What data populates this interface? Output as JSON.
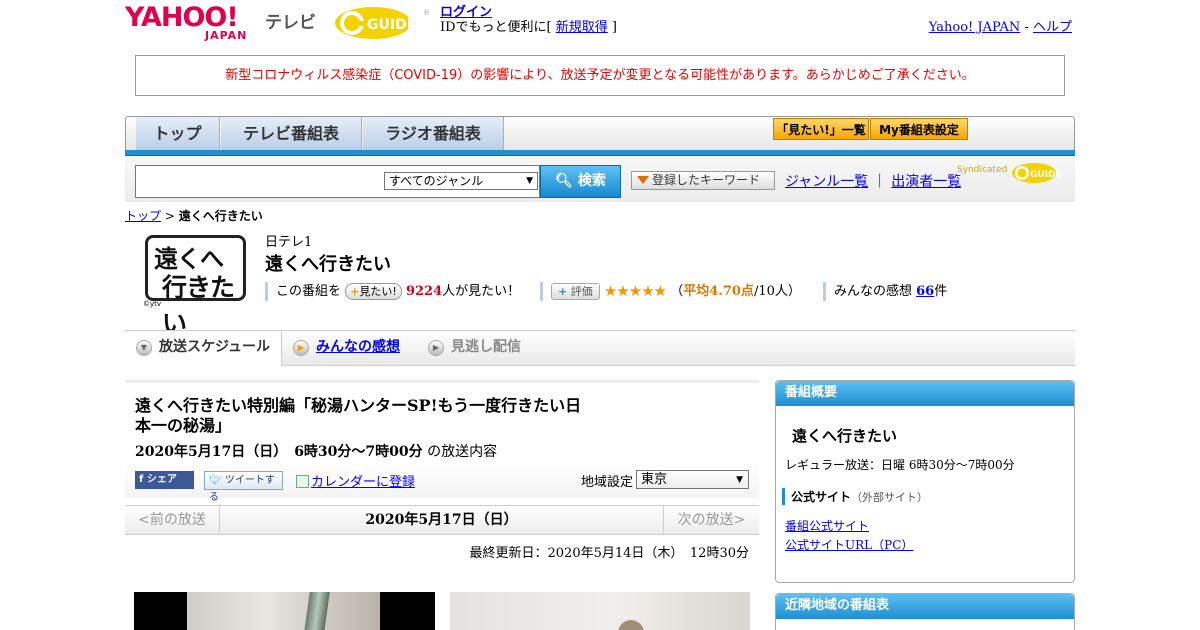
{
  "header": {
    "logo_yahoo": "YAHOO!",
    "logo_japan": "JAPAN",
    "logo_tv": "テレビ",
    "gguide": "G-GUIDE",
    "login": "ログイン",
    "login_sub_pre": "IDでもっと便利に[ ",
    "signup": "新規取得",
    "login_sub_post": " ]",
    "yahoo_japan": "Yahoo! JAPAN",
    "sep": " - ",
    "help": "ヘルプ"
  },
  "notice": "新型コロナウィルス感染症（COVID-19）の影響により、放送予定が変更となる可能性があります。あらかじめご了承ください。",
  "nav": {
    "tabs": [
      "トップ",
      "テレビ番組表",
      "ラジオ番組表"
    ],
    "want_list": "「見たい!」一覧",
    "my_guide": "My番組表設定"
  },
  "search": {
    "genre": "すべてのジャンル",
    "button": "検索",
    "keyword": "登録したキーワード",
    "genre_list": "ジャンル一覧",
    "divider": "｜",
    "cast_list": "出演者一覧",
    "syndicated": "Syndicated"
  },
  "breadcrumb": {
    "top": "トップ",
    "sep": " > ",
    "current": "遠くへ行きたい"
  },
  "program": {
    "logo_line1": "遠くへ",
    "logo_line2": "行きたい",
    "copyright": "©ytv",
    "station": "日テレ1",
    "title": "遠くへ行きたい",
    "want_pre": "この番組を",
    "want_btn": "見たい!",
    "want_count": "9224",
    "want_post": "人が見たい！",
    "eval_btn": "評価",
    "stars": "★★★★★",
    "avg_pre": "（",
    "avg": "平均4.70点",
    "avg_post": "/10人）",
    "impressions_pre": "みんなの感想 ",
    "impressions_count": "66",
    "impressions_post": "件"
  },
  "ptabs": {
    "schedule": "放送スケジュール",
    "impressions": "みんなの感想",
    "vod": "見逃し配信"
  },
  "episode": {
    "title": "遠くへ行きたい特別編「秘湯ハンターSP!もう一度行きたい日本一の秘湯」",
    "date": "2020年5月17日（日）　6時30分～7時00分",
    "date_suffix": "の放送内容",
    "share": "シェア",
    "tweet": "ツイートする",
    "calendar": "カレンダーに登録",
    "region_label": "地域設定",
    "region": "東京"
  },
  "daynav": {
    "prev": "<前の放送",
    "current": "2020年5月17日（日）",
    "next": "次の放送>"
  },
  "updated": "最終更新日：2020年5月14日（木）　12時30分",
  "sidebar": {
    "overview_head": "番組概要",
    "name": "遠くへ行きたい",
    "regular": "レギュラー放送：日曜 6時30分～7時00分",
    "official_head": "公式サイト",
    "official_note": "（外部サイト）",
    "official_link": "番組公式サイト",
    "official_pc": "公式サイトURL（PC）",
    "nearby_head": "近隣地域の番組表"
  }
}
